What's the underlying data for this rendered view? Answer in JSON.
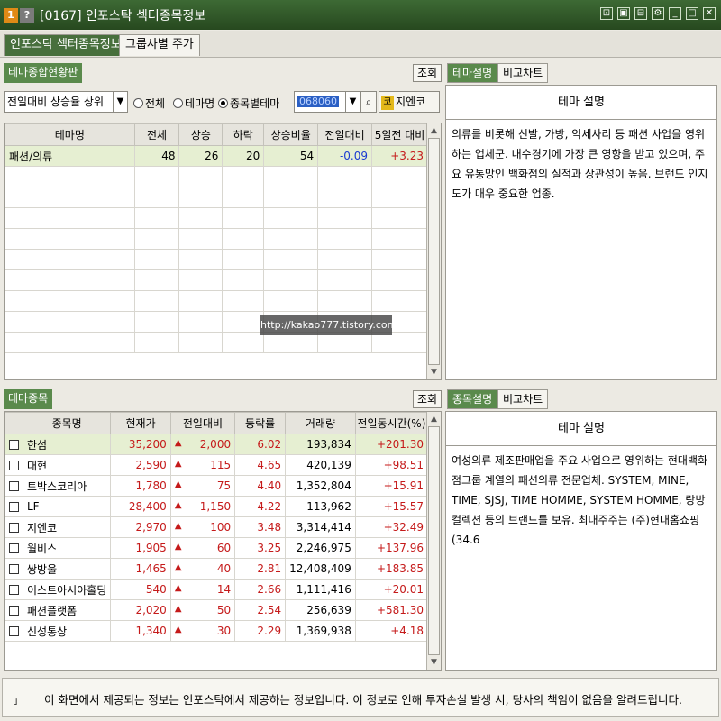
{
  "window": {
    "badge1": "1",
    "badge2": "?",
    "title": "[0167] 인포스탁 섹터종목정보",
    "controls": [
      "⊡",
      "▣",
      "⊟",
      "⚙",
      "_",
      "□",
      "✕"
    ]
  },
  "main_tabs": [
    "인포스탁 섹터종목정보",
    "그룹사별 주가"
  ],
  "theme_panel": {
    "head": "테마종합현황판",
    "query_button": "조회",
    "sort_select": "전일대비 상승율 상위",
    "radio_all": "전체",
    "radio_theme_name": "테마명",
    "radio_stock_theme": "종목별테마",
    "code_value": "068060",
    "stock_name": "지엔코",
    "stock_badge": "코",
    "columns": [
      "테마명",
      "전체",
      "상승",
      "하락",
      "상승비율",
      "전일대비",
      "5일전 대비"
    ],
    "rows": [
      {
        "name": "패션/의류",
        "total": "48",
        "up": "26",
        "down": "20",
        "ratio": "54",
        "change": "-0.09",
        "change5": "+3.23"
      }
    ]
  },
  "theme_desc": {
    "tabs": [
      "테마설명",
      "비교차트"
    ],
    "header": "테마 설명",
    "body": "의류를 비롯해 신발, 가방, 악세사리 등 패션 사업을 영위하는 업체군. 내수경기에 가장 큰 영향을 받고 있으며, 주요 유통망인 백화점의 실적과 상관성이 높음. 브랜드 인지도가 매우 중요한 업종."
  },
  "stock_panel": {
    "head": "테마종목",
    "query_button": "조회",
    "columns": [
      "종목명",
      "현재가",
      "전일대비",
      "등락률",
      "거래량",
      "전일동시간(%)"
    ],
    "rows": [
      {
        "name": "한섬",
        "price": "35,200",
        "change": "2,000",
        "rate": "6.02",
        "volume": "193,834",
        "prev": "+201.30"
      },
      {
        "name": "대현",
        "price": "2,590",
        "change": "115",
        "rate": "4.65",
        "volume": "420,139",
        "prev": "+98.51"
      },
      {
        "name": "토박스코리아",
        "price": "1,780",
        "change": "75",
        "rate": "4.40",
        "volume": "1,352,804",
        "prev": "+15.91"
      },
      {
        "name": "LF",
        "price": "28,400",
        "change": "1,150",
        "rate": "4.22",
        "volume": "113,962",
        "prev": "+15.57"
      },
      {
        "name": "지엔코",
        "price": "2,970",
        "change": "100",
        "rate": "3.48",
        "volume": "3,314,414",
        "prev": "+32.49"
      },
      {
        "name": "월비스",
        "price": "1,905",
        "change": "60",
        "rate": "3.25",
        "volume": "2,246,975",
        "prev": "+137.96"
      },
      {
        "name": "쌍방울",
        "price": "1,465",
        "change": "40",
        "rate": "2.81",
        "volume": "12,408,409",
        "prev": "+183.85"
      },
      {
        "name": "이스트아시아홀딩",
        "price": "540",
        "change": "14",
        "rate": "2.66",
        "volume": "1,111,416",
        "prev": "+20.01"
      },
      {
        "name": "패션플랫폼",
        "price": "2,020",
        "change": "50",
        "rate": "2.54",
        "volume": "256,639",
        "prev": "+581.30"
      },
      {
        "name": "신성통상",
        "price": "1,340",
        "change": "30",
        "rate": "2.29",
        "volume": "1,369,938",
        "prev": "+4.18"
      }
    ]
  },
  "stock_desc": {
    "tabs": [
      "종목설명",
      "비교차트"
    ],
    "header": "테마 설명",
    "body": "여성의류 제조판매업을 주요 사업으로 영위하는 현대백화점그룹 계열의 패션의류 전문업체. SYSTEM, MINE, TIME, SJSJ, TIME HOMME, SYSTEM HOMME, 랑방컬렉션 등의 브랜드를 보유. 최대주주는 (주)현대홈쇼핑(34.6"
  },
  "watermark": "http://kakao777.tistory.com",
  "footer": {
    "mark": "」",
    "text": "이 화면에서 제공되는 정보는 인포스탁에서 제공하는 정보입니다. 이 정보로 인해 투자손실 발생 시, 당사의 책임이 없음을 알려드립니다."
  }
}
